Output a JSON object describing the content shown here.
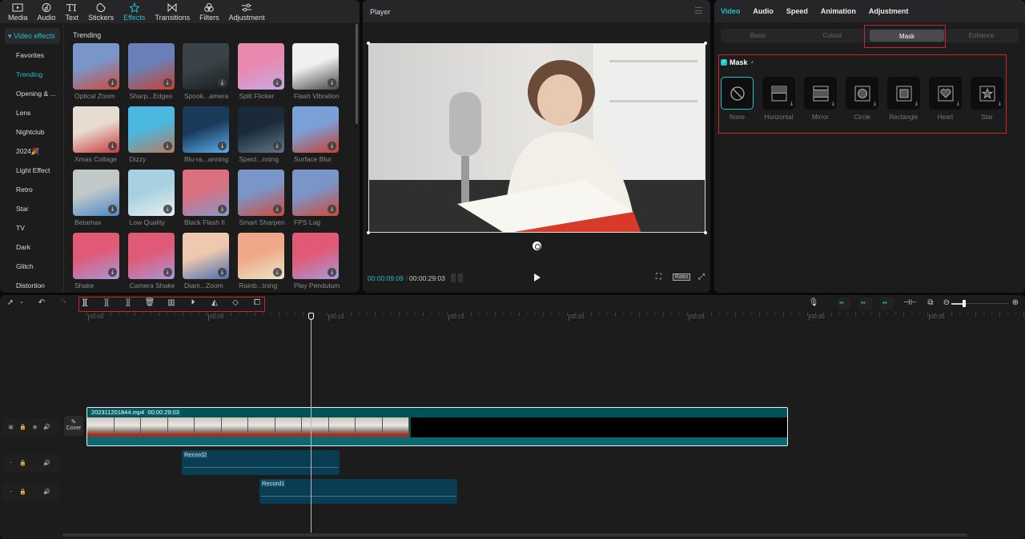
{
  "top_nav": {
    "tabs": [
      {
        "label": "Media",
        "icon": "media-icon"
      },
      {
        "label": "Audio",
        "icon": "audio-icon"
      },
      {
        "label": "Text",
        "icon": "text-icon"
      },
      {
        "label": "Stickers",
        "icon": "stickers-icon"
      },
      {
        "label": "Effects",
        "icon": "effects-icon",
        "active": true
      },
      {
        "label": "Transitions",
        "icon": "transitions-icon"
      },
      {
        "label": "Filters",
        "icon": "filters-icon"
      },
      {
        "label": "Adjustment",
        "icon": "adjustment-icon"
      }
    ]
  },
  "sidebar": {
    "header": "▾ Video effects",
    "items": [
      "Favorites",
      "Trending",
      "Opening & ...",
      "Lens",
      "Nightclub",
      "2024🎉",
      "Light Effect",
      "Retro",
      "Star",
      "TV",
      "Dark",
      "Glitch",
      "Distortion"
    ],
    "active_index": 1
  },
  "effects": {
    "section_title": "Trending",
    "items": [
      {
        "label": "Optical Zoom",
        "colors": [
          "#7a95c8",
          "#d04a3a"
        ]
      },
      {
        "label": "Sharp...Edges",
        "colors": [
          "#6a80b8",
          "#c84030"
        ]
      },
      {
        "label": "Spook...amera",
        "colors": [
          "#3a4448",
          "#1a1e20"
        ]
      },
      {
        "label": "Split Flicker",
        "colors": [
          "#e88ab0",
          "#c8a8e8"
        ]
      },
      {
        "label": "Flash Vibration",
        "colors": [
          "#f0f0f0",
          "#444"
        ]
      },
      {
        "label": "Xmas Collage",
        "colors": [
          "#e8dcd0",
          "#c83a3a"
        ]
      },
      {
        "label": "Dizzy",
        "colors": [
          "#4ab8e0",
          "#b87a60"
        ]
      },
      {
        "label": "Blu-ra...anning",
        "colors": [
          "#1a3a5a",
          "#5ab0f0"
        ]
      },
      {
        "label": "Spect...nning",
        "colors": [
          "#1a2a3a",
          "#607888"
        ]
      },
      {
        "label": "Surface Blur",
        "colors": [
          "#7aa0d8",
          "#c84030"
        ]
      },
      {
        "label": "Betamax",
        "colors": [
          "#c0c8c8",
          "#4a88c8"
        ]
      },
      {
        "label": "Low Quality",
        "colors": [
          "#a8d0e0",
          "#e8f0f0"
        ]
      },
      {
        "label": "Black Flash II",
        "colors": [
          "#d87080",
          "#8898c8"
        ]
      },
      {
        "label": "Smart Sharpen",
        "colors": [
          "#7a95c8",
          "#d04a3a"
        ]
      },
      {
        "label": "FPS Lag",
        "colors": [
          "#7a95c8",
          "#d04a3a"
        ]
      },
      {
        "label": "Shake",
        "colors": [
          "#e05a78",
          "#a898d8"
        ]
      },
      {
        "label": "Camera Shake",
        "colors": [
          "#e05a78",
          "#a898d8"
        ]
      },
      {
        "label": "Diam...Zoom",
        "colors": [
          "#f0c8b0",
          "#4870b0"
        ]
      },
      {
        "label": "Rainb...tning",
        "colors": [
          "#f0a888",
          "#e8e8c8"
        ]
      },
      {
        "label": "Play Pendulum",
        "colors": [
          "#e05a78",
          "#a898d8"
        ]
      }
    ]
  },
  "player": {
    "title": "Player",
    "current_time": "00:00:09:09",
    "separator": "/",
    "total_time": "00:00:29:03",
    "ratio_label": "Ratio"
  },
  "properties": {
    "tabs": [
      "Video",
      "Audio",
      "Speed",
      "Animation",
      "Adjustment"
    ],
    "active_tab": 0,
    "subtabs": [
      "Basic",
      "Cutout",
      "Mask",
      "Enhance"
    ],
    "active_subtab": 2,
    "mask": {
      "title": "Mask",
      "enabled": true,
      "options": [
        {
          "label": "None",
          "icon": "none-mask-icon",
          "selected": true
        },
        {
          "label": "Horizontal",
          "icon": "horizontal-mask-icon"
        },
        {
          "label": "Mirror",
          "icon": "mirror-mask-icon"
        },
        {
          "label": "Circle",
          "icon": "circle-mask-icon"
        },
        {
          "label": "Rectangle",
          "icon": "rectangle-mask-icon"
        },
        {
          "label": "Heart",
          "icon": "heart-mask-icon"
        },
        {
          "label": "Star",
          "icon": "star-mask-icon"
        }
      ]
    }
  },
  "timeline": {
    "ruler_labels": [
      "00:00",
      "00:05",
      "00:10",
      "00:15",
      "00:20",
      "00:25",
      "00:30",
      "00:35"
    ],
    "cover_label": "Cover",
    "main_clip": {
      "filename": "202311201844.mp4",
      "duration": "00:00:29:03"
    },
    "audio_clips": [
      {
        "name": "Record2"
      },
      {
        "name": "Record1"
      }
    ],
    "zoom_level": 0.4
  },
  "colors": {
    "accent": "#21bfc9",
    "highlight_box": "#d2232a",
    "clip_bg": "#005158",
    "audio_clip_bg": "#083d52"
  }
}
